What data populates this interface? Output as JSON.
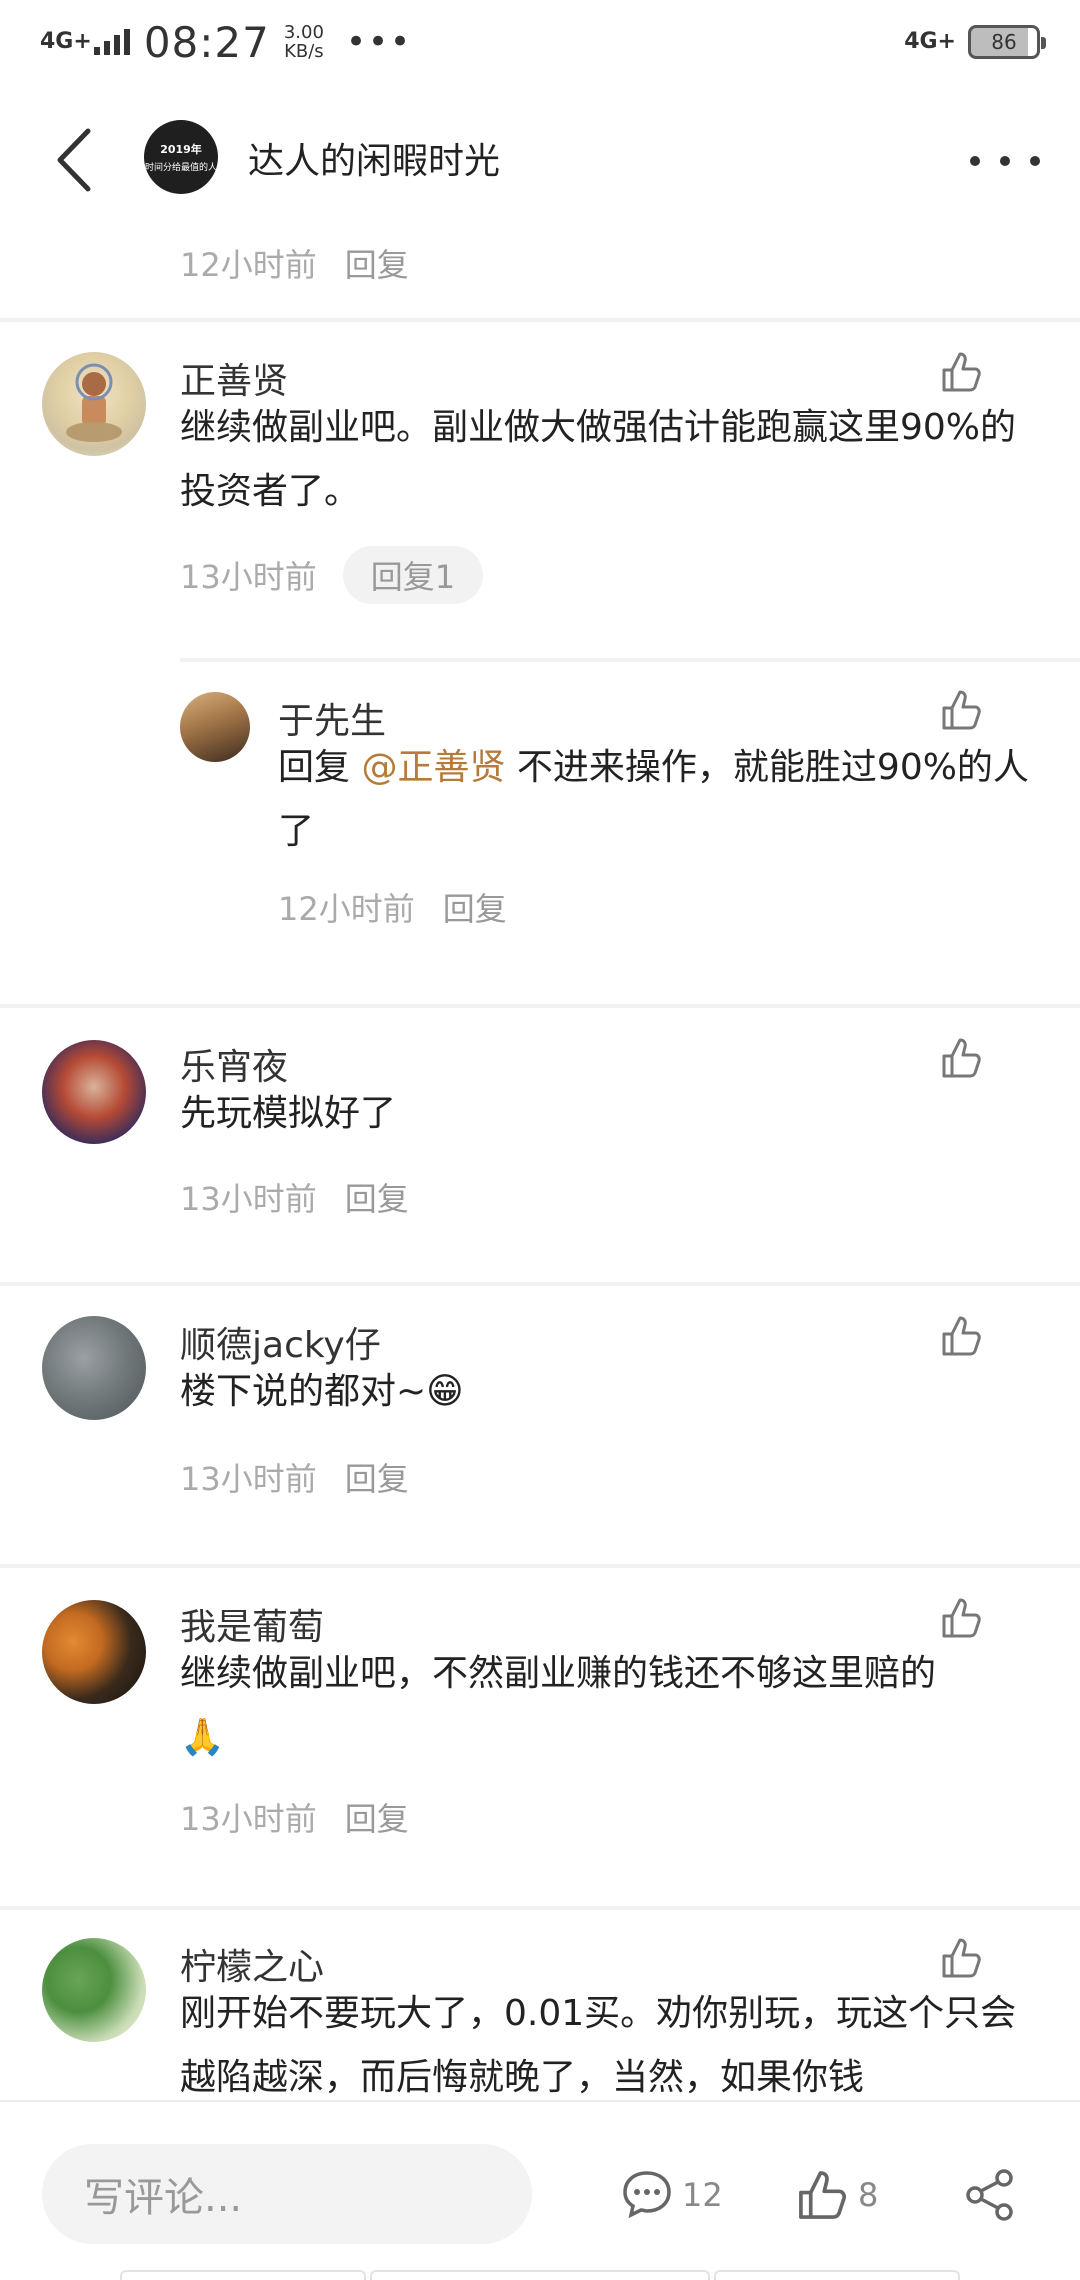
{
  "status_bar": {
    "network_left": "4G+",
    "time": "08:27",
    "speed_value": "3.00",
    "speed_unit": "KB/s",
    "network_right": "4G+",
    "battery": "86"
  },
  "header": {
    "title": "达人的闲暇时光",
    "avatar_year": "2019年",
    "avatar_text": "时间分给最值的人"
  },
  "top_meta": {
    "time": "12小时前",
    "reply": "回复"
  },
  "comments": [
    {
      "name": "正善贤",
      "text": "继续做副业吧。副业做大做强估计能跑赢这里90%的投资者了。",
      "time": "13小时前",
      "reply": "回复1",
      "sub_reply": {
        "name": "于先生",
        "prefix": "回复 ",
        "mention": "@正善贤",
        "text": " 不进来操作，就能胜过90%的人了",
        "time": "12小时前",
        "reply": "回复"
      }
    },
    {
      "name": "乐宵夜",
      "text": "先玩模拟好了",
      "time": "13小时前",
      "reply": "回复"
    },
    {
      "name": "顺德jacky仔",
      "text": "楼下说的都对~",
      "emoji": "😁",
      "time": "13小时前",
      "reply": "回复"
    },
    {
      "name": "我是葡萄",
      "text": "继续做副业吧，不然副业赚的钱还不够这里赔的",
      "emoji": "🙏",
      "time": "13小时前",
      "reply": "回复"
    },
    {
      "name": "柠檬之心",
      "text": "刚开始不要玩大了，0.01买。劝你别玩，玩这个只会越陷越深，而后悔就晚了，当然，如果你钱"
    }
  ],
  "bottom_bar": {
    "placeholder": "写评论...",
    "comment_count": "12",
    "like_count": "8"
  },
  "colors": {
    "mention": "#b67b3a",
    "meta": "#aaaaaa",
    "divider": "#f1f1f1"
  }
}
